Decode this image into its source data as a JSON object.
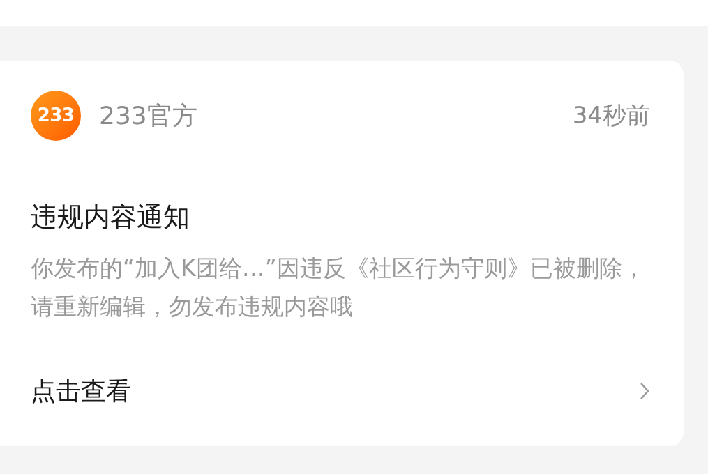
{
  "notification": {
    "sender": {
      "logo_text": "233",
      "name": "233官方"
    },
    "time": "34秒前",
    "title": "违规内容通知",
    "body": "你发布的“加入K团给…”因违反《社区行为守则》已被删除，请重新编辑，勿发布违规内容哦",
    "action": "点击查看"
  }
}
